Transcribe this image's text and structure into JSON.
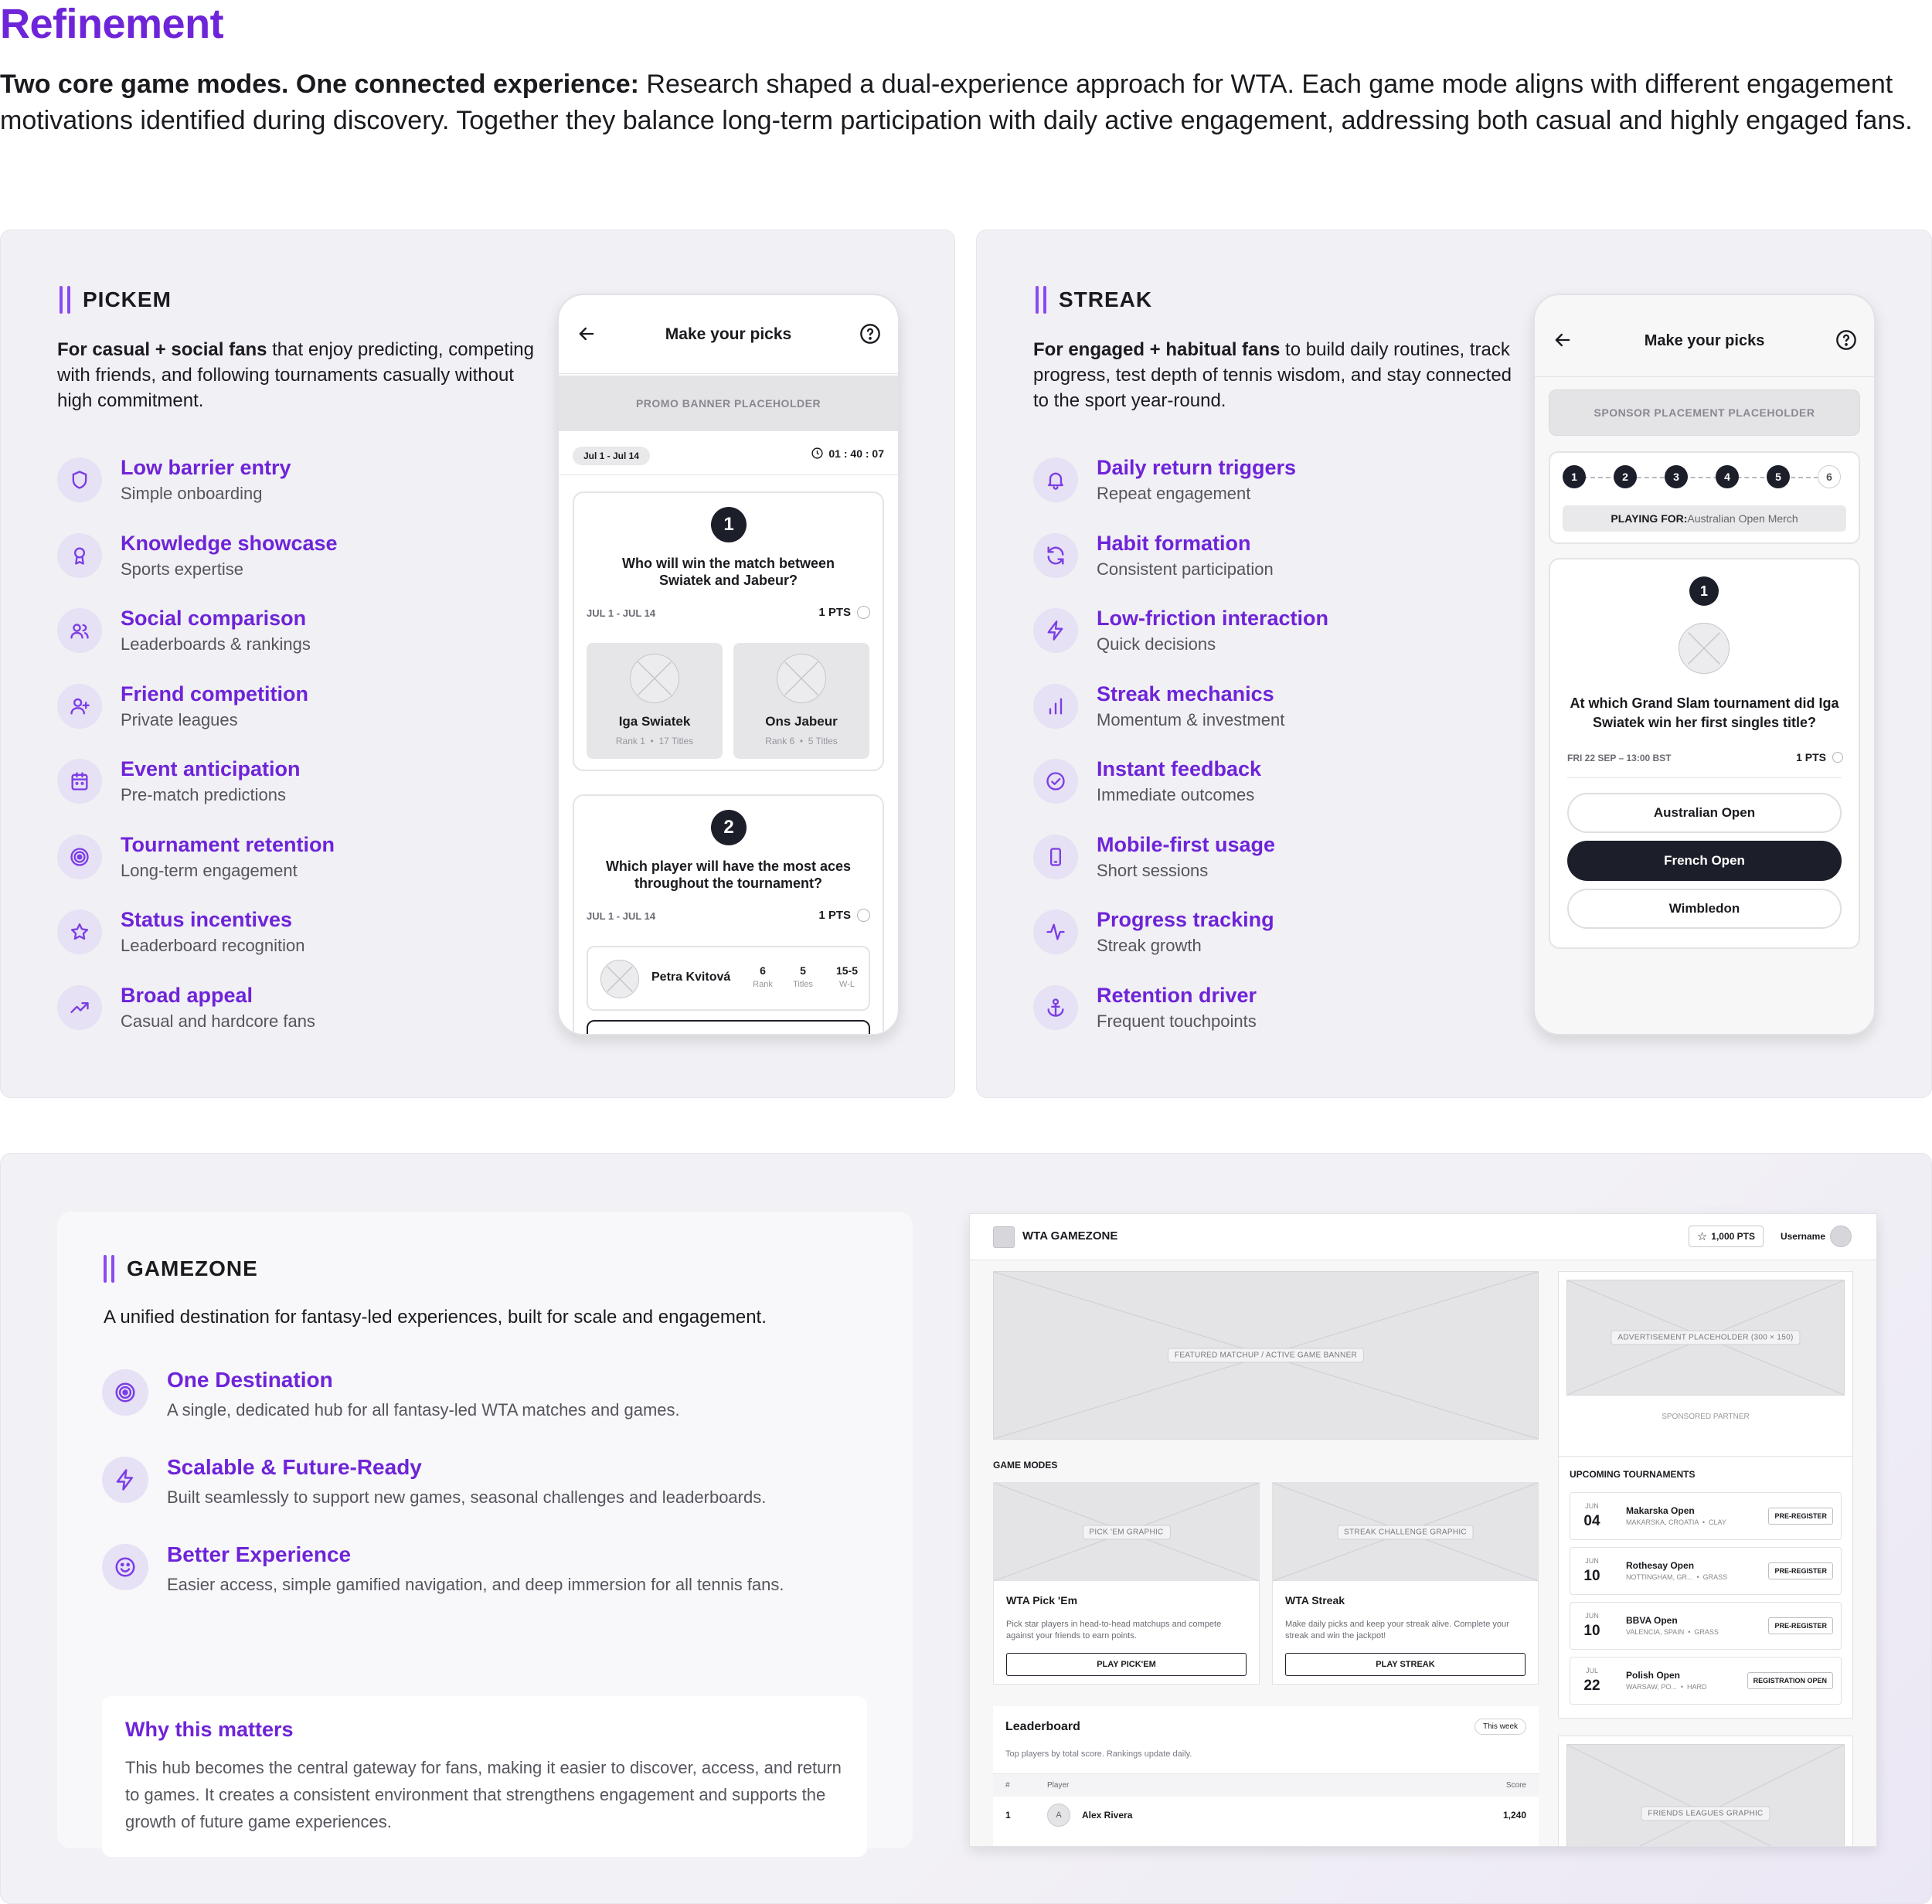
{
  "page": {
    "title": "Refinement",
    "intro_bold": "Two core game modes. One connected experience:",
    "intro_rest": " Research shaped a dual-experience approach for WTA. Each game mode aligns with different engagement motivations identified during discovery. Together they balance long-term participation with daily active engagement, addressing both casual and highly engaged fans."
  },
  "pickem": {
    "title": "PICKEM",
    "desc_bold": "For casual + social fans",
    "desc_rest": " that enjoy predicting, competing with friends, and following tournaments casually without high commitment.",
    "features": [
      {
        "icon": "shield-icon",
        "title": "Low barrier entry",
        "sub": "Simple onboarding"
      },
      {
        "icon": "award-icon",
        "title": "Knowledge showcase",
        "sub": "Sports expertise"
      },
      {
        "icon": "users-icon",
        "title": "Social comparison",
        "sub": "Leaderboards & rankings"
      },
      {
        "icon": "user-plus-icon",
        "title": "Friend competition",
        "sub": "Private leagues"
      },
      {
        "icon": "calendar-icon",
        "title": "Event anticipation",
        "sub": "Pre-match predictions"
      },
      {
        "icon": "target-icon",
        "title": "Tournament retention",
        "sub": "Long-term engagement"
      },
      {
        "icon": "star-icon",
        "title": "Status incentives",
        "sub": "Leaderboard recognition"
      },
      {
        "icon": "trending-up-icon",
        "title": "Broad appeal",
        "sub": "Casual and hardcore fans"
      }
    ],
    "phone": {
      "title": "Make your picks",
      "banner": "PROMO BANNER PLACEHOLDER",
      "date_chip": "Jul 1 - Jul 14",
      "timer": "01 : 40 : 07",
      "q1": {
        "num": "1",
        "text": "Who will win the match between Swiatek and Jabeur?",
        "date": "JUL 1 - JUL 14",
        "pts": "1 PTS",
        "p1_name": "Iga Swiatek",
        "p1_rank": "Rank 1",
        "p1_titles": "17 Titles",
        "p2_name": "Ons Jabeur",
        "p2_rank": "Rank 6",
        "p2_titles": "5 Titles"
      },
      "q2": {
        "num": "2",
        "text": "Which player will have the most aces throughout the tournament?",
        "date": "JUL 1 - JUL 14",
        "pts": "1 PTS",
        "player": "Petra Kvitová",
        "rank_val": "6",
        "rank_lbl": "Rank",
        "titles_val": "5",
        "titles_lbl": "Titles",
        "wl_val": "15-5",
        "wl_lbl": "W-L"
      }
    }
  },
  "streak": {
    "title": "STREAK",
    "desc_bold": "For engaged + habitual fans",
    "desc_rest": " to build daily routines, track progress, test depth of tennis wisdom, and stay connected to the sport year-round.",
    "features": [
      {
        "icon": "bell-icon",
        "title": "Daily return triggers",
        "sub": "Repeat engagement"
      },
      {
        "icon": "refresh-icon",
        "title": "Habit formation",
        "sub": "Consistent participation"
      },
      {
        "icon": "bolt-icon",
        "title": "Low-friction interaction",
        "sub": "Quick decisions"
      },
      {
        "icon": "bar-chart-icon",
        "title": "Streak mechanics",
        "sub": "Momentum & investment"
      },
      {
        "icon": "check-circle-icon",
        "title": "Instant feedback",
        "sub": "Immediate outcomes"
      },
      {
        "icon": "smartphone-icon",
        "title": "Mobile-first usage",
        "sub": "Short sessions"
      },
      {
        "icon": "activity-icon",
        "title": "Progress tracking",
        "sub": "Streak growth"
      },
      {
        "icon": "anchor-icon",
        "title": "Retention driver",
        "sub": "Frequent touchpoints"
      }
    ],
    "phone": {
      "title": "Make your picks",
      "banner": "SPONSOR PLACEMENT PLACEHOLDER",
      "steps": [
        "1",
        "2",
        "3",
        "4",
        "5",
        "6"
      ],
      "playing_label": "PLAYING FOR:",
      "playing_value": " Australian Open Merch",
      "q_num": "1",
      "q_text": "At which Grand Slam tournament did Iga Swiatek win her first singles title?",
      "q_date": "FRI 22 SEP – 13:00 BST",
      "q_pts": "1 PTS",
      "options": [
        "Australian Open",
        "French Open",
        "Wimbledon"
      ]
    }
  },
  "gamezone": {
    "title": "GAMEZONE",
    "desc": "A unified destination for fantasy-led experiences, built for scale and engagement.",
    "features": [
      {
        "icon": "target-icon",
        "title": "One Destination",
        "sub": "A single, dedicated hub for all fantasy-led WTA matches and games."
      },
      {
        "icon": "bolt-icon",
        "title": "Scalable & Future-Ready",
        "sub": "Built seamlessly to support new games, seasonal challenges and leaderboards."
      },
      {
        "icon": "smile-icon",
        "title": "Better Experience",
        "sub": "Easier access, simple gamified navigation, and deep immersion for all tennis fans."
      }
    ],
    "why_title": "Why this matters",
    "why_text": "This hub becomes the central gateway for fans, making it easier to discover, access, and return to games. It creates a consistent environment that strengthens engagement and supports the growth of future game experiences.",
    "mock": {
      "brand": "WTA GAMEZONE",
      "points": "1,000 PTS",
      "username": "Username",
      "featured": "FEATURED MATCHUP / ACTIVE GAME BANNER",
      "ad": "ADVERTISEMENT PLACEHOLDER (300 × 150)",
      "sponsor": "SPONSORED PARTNER",
      "modes_title": "GAME MODES",
      "modes": [
        {
          "graphic": "PICK 'EM GRAPHIC",
          "title": "WTA Pick 'Em",
          "desc": "Pick star players in head-to-head matchups and compete against your friends to earn points.",
          "cta": "PLAY PICK'EM"
        },
        {
          "graphic": "STREAK CHALLENGE GRAPHIC",
          "title": "WTA Streak",
          "desc": "Make daily picks and keep your streak alive. Complete your streak and win the jackpot!",
          "cta": "PLAY STREAK"
        }
      ],
      "tour_title": "UPCOMING TOURNAMENTS",
      "tournaments": [
        {
          "month": "JUN",
          "day": "04",
          "name": "Makarska Open",
          "loc": "MAKARSKA, CROATIA",
          "surface": "CLAY",
          "cta": "PRE-REGISTER"
        },
        {
          "month": "JUN",
          "day": "10",
          "name": "Rothesay Open",
          "loc": "NOTTINGHAM, GR...",
          "surface": "GRASS",
          "cta": "PRE-REGISTER"
        },
        {
          "month": "JUN",
          "day": "10",
          "name": "BBVA Open",
          "loc": "VALENCIA, SPAIN",
          "surface": "GRASS",
          "cta": "PRE-REGISTER"
        },
        {
          "month": "JUL",
          "day": "22",
          "name": "Polish Open",
          "loc": "WARSAW, PO...",
          "surface": "HARD",
          "cta": "REGISTRATION OPEN"
        }
      ],
      "leaderboard_title": "Leaderboard",
      "leaderboard_filter": "This week",
      "leaderboard_sub": "Top players by total score. Rankings update daily.",
      "lb_col_rank": "#",
      "lb_col_player": "Player",
      "lb_col_score": "Score",
      "lb_rows": [
        {
          "rank": "1",
          "avatar": "A",
          "name": "Alex Rivera",
          "score": "1,240"
        }
      ],
      "friends": "FRIENDS LEAGUES GRAPHIC"
    }
  }
}
